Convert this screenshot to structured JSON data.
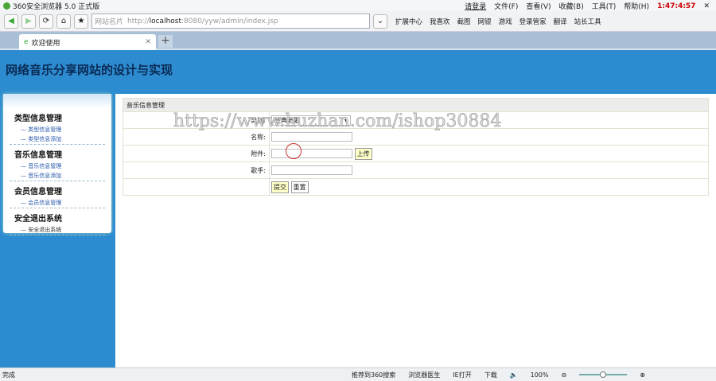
{
  "browser": {
    "title": "360安全浏览器 5.0 正式版",
    "login": "请登录",
    "menus": [
      "文件(F)",
      "查看(V)",
      "收藏(B)",
      "工具(T)",
      "帮助(H)"
    ],
    "clock": "1:47:4:57",
    "address_label": "网站名片",
    "url_prefix": "http://",
    "url_host": "localhost",
    "url_rest": ":8080/yyw/admin/index.jsp",
    "toolbar_items": [
      "扩展中心",
      "我喜欢",
      "截图",
      "网银",
      "游戏",
      "登录管家",
      "翻译",
      "站长工具"
    ],
    "tab": "欢迎使用"
  },
  "header": {
    "title": "网络音乐分享网站的设计与实现"
  },
  "sidebar": {
    "groups": [
      {
        "title": "类型信息管理",
        "links": [
          "类型信息管理",
          "类型信息添加"
        ]
      },
      {
        "title": "音乐信息管理",
        "links": [
          "音乐信息管理",
          "音乐信息添加"
        ]
      },
      {
        "title": "会员信息管理",
        "links": [
          "会员信息管理"
        ]
      },
      {
        "title": "安全退出系统",
        "links": [
          "安全退出系统"
        ]
      }
    ]
  },
  "form": {
    "heading": "音乐信息管理",
    "category_label": "类别:",
    "category_value": "经典老歌",
    "name_label": "名称:",
    "attachment_label": "附件:",
    "upload": "上传",
    "singer_label": "歌手:",
    "submit": "提交",
    "reset": "重置"
  },
  "watermark": "https://www.huzhan.com/ishop30884",
  "status": {
    "left": "完成",
    "items": [
      "推荐到360搜索",
      "浏览器医生",
      "IE打开",
      "下载"
    ],
    "zoom": "100%"
  }
}
